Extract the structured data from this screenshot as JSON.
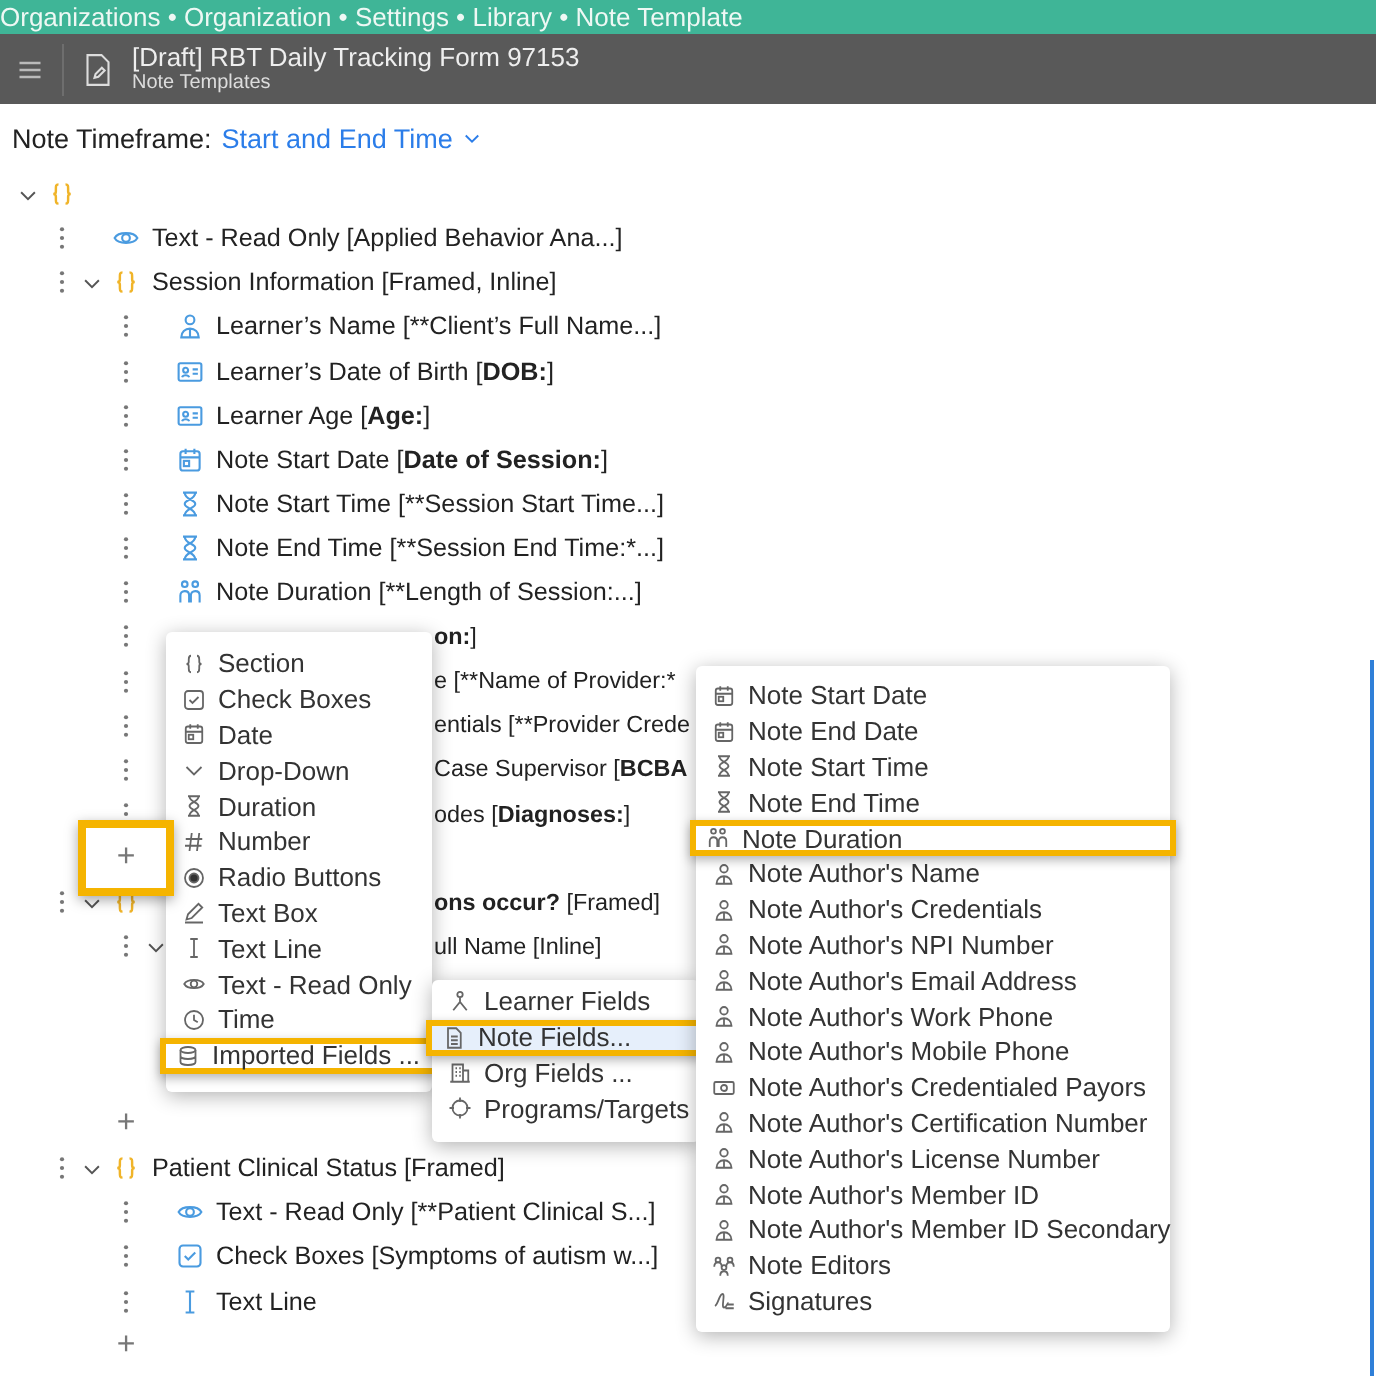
{
  "breadcrumb": "Organizations • Organization • Settings • Library • Note Template",
  "header": {
    "title": "[Draft] RBT Daily Tracking Form 97153",
    "subtitle": "Note Templates"
  },
  "timeframe": {
    "label": "Note Timeframe:",
    "value": "Start and End Time"
  },
  "tree": {
    "kind": "section",
    "expanded": true,
    "children": [
      {
        "kind": "readonly",
        "text": [
          {
            "text": "Text - Read Only [Applied Behavior Ana...]",
            "bold": false
          }
        ]
      },
      {
        "kind": "section",
        "text": [
          {
            "text": "Session Information [Framed, Inline]",
            "bold": false
          }
        ],
        "expanded": true,
        "children": [
          {
            "kind": "person",
            "text": [
              {
                "text": "Learner’s Name [**Client’s Full Name...]",
                "bold": false
              }
            ]
          },
          {
            "kind": "id",
            "text": [
              {
                "text": "Learner’s Date of Birth [",
                "bold": false
              },
              {
                "text": "DOB:",
                "bold": true
              },
              {
                "text": "]",
                "bold": false
              }
            ]
          },
          {
            "kind": "id",
            "text": [
              {
                "text": "Learner Age [",
                "bold": false
              },
              {
                "text": "Age:",
                "bold": true
              },
              {
                "text": "]",
                "bold": false
              }
            ]
          },
          {
            "kind": "date",
            "text": [
              {
                "text": "Note Start Date [",
                "bold": false
              },
              {
                "text": "Date of Session:",
                "bold": true
              },
              {
                "text": "]",
                "bold": false
              }
            ]
          },
          {
            "kind": "time",
            "text": [
              {
                "text": "Note Start Time [**Session Start Time...]",
                "bold": false
              }
            ]
          },
          {
            "kind": "time",
            "text": [
              {
                "text": "Note End Time [**Session End Time:*...]",
                "bold": false
              }
            ]
          },
          {
            "kind": "duration",
            "text": [
              {
                "text": "Note Duration [**Length of Session:...]",
                "bold": false
              }
            ]
          },
          {
            "kind": "field",
            "text": [
              {
                "text": "on:",
                "bold": true
              },
              {
                "text": "]",
                "bold": false
              }
            ],
            "covered": true
          },
          {
            "kind": "field",
            "text": [
              {
                "text": "e [**Name of Provider:*",
                "bold": false
              }
            ],
            "covered": true
          },
          {
            "kind": "field",
            "text": [
              {
                "text": "entials [**Provider Crede",
                "bold": false
              }
            ],
            "covered": true
          },
          {
            "kind": "field",
            "text": [
              {
                "text": "Case Supervisor [",
                "bold": false
              },
              {
                "text": "BCBA",
                "bold": true
              }
            ],
            "covered": true
          },
          {
            "kind": "field",
            "text": [
              {
                "text": "odes [",
                "bold": false
              },
              {
                "text": "Diagnoses:",
                "bold": true
              },
              {
                "text": "]",
                "bold": false
              }
            ],
            "covered": true
          },
          {
            "kind": "add",
            "text": "+",
            "highlighted": true
          }
        ]
      },
      {
        "kind": "section",
        "text": [
          {
            "text": "ons occur?",
            "bold": true
          },
          {
            "text": " [Framed]",
            "bold": false
          }
        ],
        "covered": true,
        "expanded": true,
        "children": [
          {
            "kind": "section",
            "text": [
              {
                "text": "ull Name [Inline]",
                "bold": false
              }
            ],
            "covered": true,
            "expanded": true
          },
          {
            "kind": "add",
            "text": "+",
            "highlighted": false
          }
        ]
      },
      {
        "kind": "section",
        "text": [
          {
            "text": "Patient Clinical Status [Framed]",
            "bold": false
          }
        ],
        "expanded": true,
        "children": [
          {
            "kind": "readonly",
            "text": [
              {
                "text": "Text - Read Only [**Patient Clinical S...]",
                "bold": false
              }
            ]
          },
          {
            "kind": "checkbox",
            "text": [
              {
                "text": "Check Boxes [Symptoms of autism w...]",
                "bold": false
              }
            ]
          },
          {
            "kind": "textline",
            "text": [
              {
                "text": "Text Line",
                "bold": false
              }
            ]
          },
          {
            "kind": "add",
            "text": "+",
            "highlighted": false
          }
        ]
      }
    ]
  },
  "add_menu": {
    "items": [
      {
        "kind": "section",
        "label": "Section",
        "selected": false,
        "highlighted": false
      },
      {
        "kind": "checkbox",
        "label": "Check Boxes",
        "selected": false,
        "highlighted": false
      },
      {
        "kind": "date",
        "label": "Date",
        "selected": false,
        "highlighted": false
      },
      {
        "kind": "dropdown",
        "label": "Drop-Down",
        "selected": false,
        "highlighted": false
      },
      {
        "kind": "time",
        "label": "Duration",
        "selected": false,
        "highlighted": false
      },
      {
        "kind": "number",
        "label": "Number",
        "selected": false,
        "highlighted": false
      },
      {
        "kind": "radio",
        "label": "Radio Buttons",
        "selected": false,
        "highlighted": false
      },
      {
        "kind": "textbox",
        "label": "Text Box",
        "selected": false,
        "highlighted": false
      },
      {
        "kind": "textline",
        "label": "Text Line",
        "selected": false,
        "highlighted": false
      },
      {
        "kind": "readonly",
        "label": "Text - Read Only",
        "selected": false,
        "highlighted": false
      },
      {
        "kind": "clock",
        "label": "Time",
        "selected": false,
        "highlighted": false
      },
      {
        "kind": "imported",
        "label": "Imported Fields ...",
        "selected": false,
        "highlighted": true
      }
    ]
  },
  "imported_menu": {
    "items": [
      {
        "kind": "learner",
        "label": "Learner Fields",
        "selected": false,
        "highlighted": false
      },
      {
        "kind": "note",
        "label": "Note Fields...",
        "selected": true,
        "highlighted": true
      },
      {
        "kind": "org",
        "label": "Org Fields ...",
        "selected": false,
        "highlighted": false
      },
      {
        "kind": "target",
        "label": "Programs/Targets",
        "selected": false,
        "highlighted": false
      }
    ]
  },
  "note_fields_menu": {
    "items": [
      {
        "kind": "date",
        "label": "Note Start Date",
        "selected": false,
        "highlighted": false
      },
      {
        "kind": "date",
        "label": "Note End Date",
        "selected": false,
        "highlighted": false
      },
      {
        "kind": "time",
        "label": "Note Start Time",
        "selected": false,
        "highlighted": false
      },
      {
        "kind": "time",
        "label": "Note End Time",
        "selected": false,
        "highlighted": false
      },
      {
        "kind": "duration",
        "label": "Note Duration",
        "selected": false,
        "highlighted": true
      },
      {
        "kind": "person",
        "label": "Note Author's Name",
        "selected": false,
        "highlighted": false
      },
      {
        "kind": "person",
        "label": "Note Author's Credentials",
        "selected": false,
        "highlighted": false
      },
      {
        "kind": "person",
        "label": "Note Author's NPI Number",
        "selected": false,
        "highlighted": false
      },
      {
        "kind": "person",
        "label": "Note Author's Email Address",
        "selected": false,
        "highlighted": false
      },
      {
        "kind": "person",
        "label": "Note Author's Work Phone",
        "selected": false,
        "highlighted": false
      },
      {
        "kind": "person",
        "label": "Note Author's Mobile Phone",
        "selected": false,
        "highlighted": false
      },
      {
        "kind": "payors",
        "label": "Note Author's Credentialed Payors",
        "selected": false,
        "highlighted": false
      },
      {
        "kind": "person",
        "label": "Note Author's Certification Number",
        "selected": false,
        "highlighted": false
      },
      {
        "kind": "person",
        "label": "Note Author's License Number",
        "selected": false,
        "highlighted": false
      },
      {
        "kind": "person",
        "label": "Note Author's Member ID",
        "selected": false,
        "highlighted": false
      },
      {
        "kind": "person",
        "label": "Note Author's Member ID Secondary",
        "selected": false,
        "highlighted": false
      },
      {
        "kind": "editors",
        "label": "Note Editors",
        "selected": false,
        "highlighted": false
      },
      {
        "kind": "signature",
        "label": "Signatures",
        "selected": false,
        "highlighted": false
      }
    ]
  }
}
